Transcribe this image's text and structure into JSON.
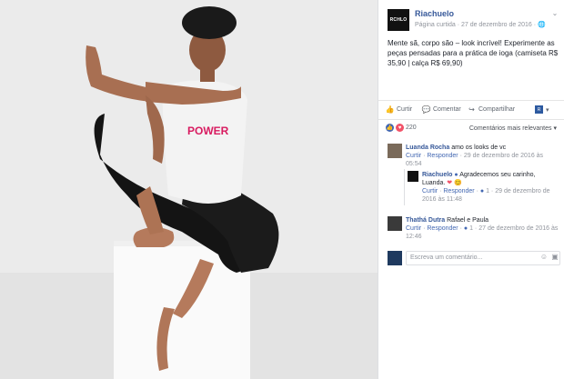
{
  "page": {
    "name": "Riachuelo",
    "logo_text": "RCHLO",
    "meta": "Página curtida · 27 de dezembro de 2016 · ",
    "post_text": "Mente sã, corpo são – look incrível! Experimente as peças pensadas para a prática de ioga (camiseta R$ 35,90 | calça R$ 69,90)"
  },
  "photo": {
    "shirt_text": "POWER"
  },
  "actions": {
    "like": "Curtir",
    "comment": "Comentar",
    "share": "Compartilhar"
  },
  "reactions": {
    "count": "220",
    "sort": "Comentários mais relevantes"
  },
  "comments": [
    {
      "name": "Luanda Rocha",
      "text": "amo os looks de vc",
      "like": "Curtir",
      "reply": "Responder",
      "time": "29 de dezembro de 2016 às 05:54"
    },
    {
      "name": "Riachuelo",
      "text": "Agradecemos seu carinho, Luanda.",
      "emoji": "❤ 😊",
      "like": "Curtir",
      "reply": "Responder",
      "count": "1",
      "time": "29 de dezembro de 2016 às 11:48"
    },
    {
      "name": "Thathá Dutra",
      "text": "Rafael e Paula",
      "like": "Curtir",
      "reply": "Responder",
      "count": "1",
      "time": "27 de dezembro de 2016 às 12:46"
    }
  ],
  "compose": {
    "placeholder": "Escreva um comentário..."
  },
  "colors": {
    "link": "#365899",
    "muted": "#90949c",
    "like_blue": "#4267b2",
    "love_red": "#f25268"
  }
}
